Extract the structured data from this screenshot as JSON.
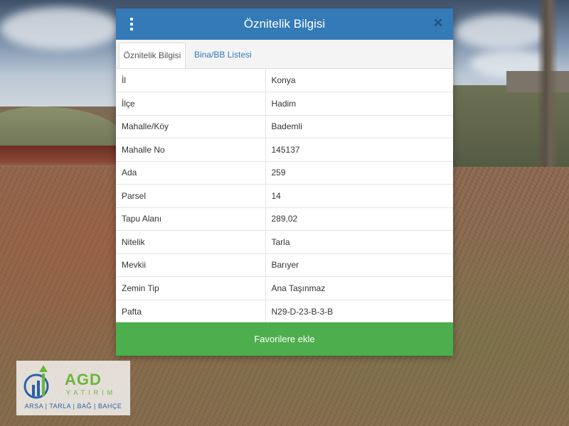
{
  "dialog": {
    "title": "Öznitelik Bilgisi",
    "tabs": [
      {
        "label": "Öznitelik Bilgisi",
        "active": true
      },
      {
        "label": "Bina/BB Listesi",
        "active": false
      }
    ],
    "rows": [
      {
        "key": "İl",
        "value": "Konya"
      },
      {
        "key": "İlçe",
        "value": "Hadim"
      },
      {
        "key": "Mahalle/Köy",
        "value": "Bademli"
      },
      {
        "key": "Mahalle No",
        "value": "145137"
      },
      {
        "key": "Ada",
        "value": "259"
      },
      {
        "key": "Parsel",
        "value": "14"
      },
      {
        "key": "Tapu Alanı",
        "value": "289,02"
      },
      {
        "key": "Nitelik",
        "value": "Tarla"
      },
      {
        "key": "Mevkii",
        "value": "Barıyer"
      },
      {
        "key": "Zemin Tip",
        "value": "Ana Taşınmaz"
      },
      {
        "key": "Pafta",
        "value": "N29-D-23-B-3-B"
      }
    ],
    "favorite_button": "Favorilere ekle",
    "icons": {
      "menu": "vertical-dots-icon",
      "close": "close-icon"
    }
  },
  "logo": {
    "name": "AGD",
    "subtitle": "YATIRIM",
    "tagline": "ARSA | TARLA | BAĞ | BAHÇE"
  },
  "colors": {
    "header": "#337ab7",
    "button": "#4cae4c",
    "link": "#337ab7"
  }
}
